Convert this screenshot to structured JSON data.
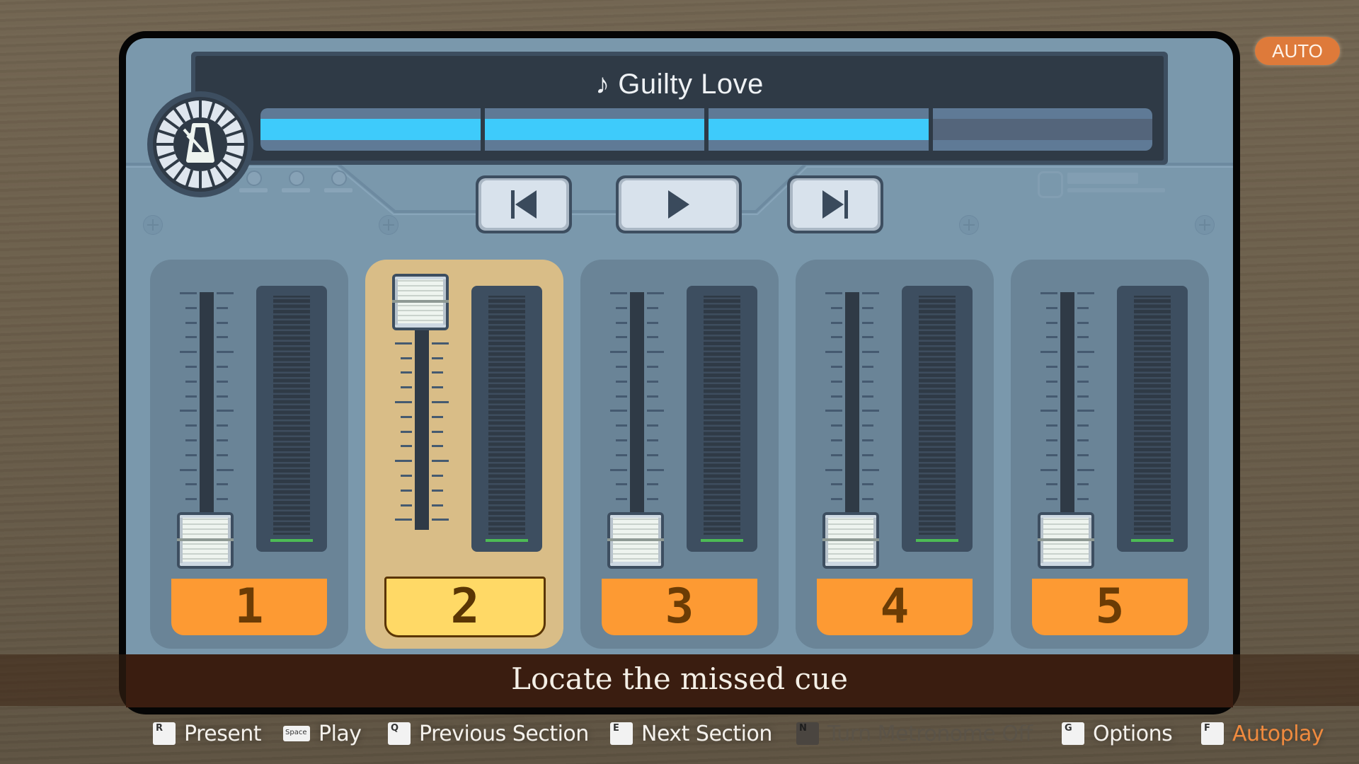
{
  "auto_badge": "AUTO",
  "player": {
    "song_title": "♪ Guilty Love",
    "progress": {
      "sections_total": 4,
      "sections_completed": 3
    }
  },
  "metronome": {
    "icon": "metronome-icon",
    "state": "on"
  },
  "transport": {
    "previous": {
      "icon": "skip-previous-icon"
    },
    "play": {
      "icon": "play-icon"
    },
    "next": {
      "icon": "skip-next-icon"
    }
  },
  "channels": [
    {
      "label": "1",
      "fader_level": 0.0,
      "meter_level": 0.0,
      "selected": false
    },
    {
      "label": "2",
      "fader_level": 1.0,
      "meter_level": 0.0,
      "selected": true
    },
    {
      "label": "3",
      "fader_level": 0.0,
      "meter_level": 0.0,
      "selected": false
    },
    {
      "label": "4",
      "fader_level": 0.0,
      "meter_level": 0.0,
      "selected": false
    },
    {
      "label": "5",
      "fader_level": 0.0,
      "meter_level": 0.0,
      "selected": false
    }
  ],
  "subtitle": "Locate the missed cue",
  "hints": [
    {
      "key": "R",
      "label": "Present",
      "state": "normal"
    },
    {
      "key": "Space",
      "label": "Play",
      "state": "normal"
    },
    {
      "key": "Q",
      "label": "Previous Section",
      "state": "normal"
    },
    {
      "key": "E",
      "label": "Next Section",
      "state": "normal"
    },
    {
      "key": "N",
      "label": "Turn Metronome Off",
      "state": "disabled"
    },
    {
      "key": "G",
      "label": "Options",
      "state": "normal"
    },
    {
      "key": "F",
      "label": "Autoplay",
      "state": "accent"
    }
  ],
  "colors": {
    "panel": "#7a98ac",
    "display": "#2f3a46",
    "progress_fill": "#3ecbfb",
    "channel_label": "#fd9a33",
    "channel_label_selected": "#ffd966",
    "selected_strip": "#d9bd87",
    "meter_level": "#4dbb55",
    "accent": "#f08a3e"
  }
}
